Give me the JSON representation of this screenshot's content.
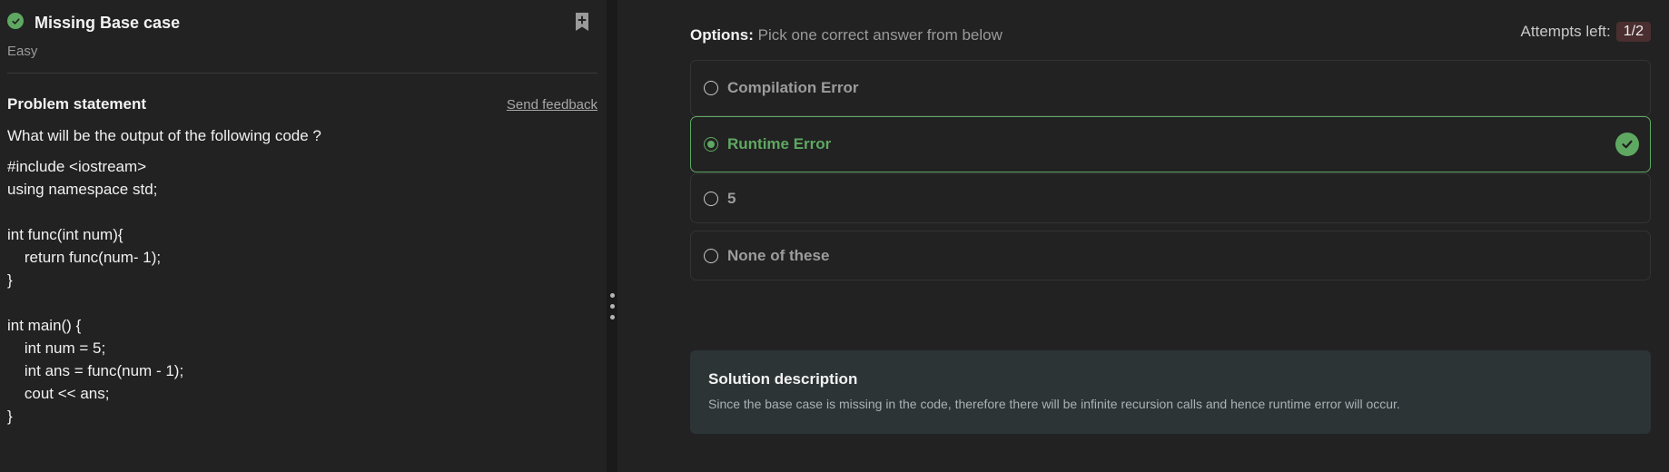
{
  "problem": {
    "title": "Missing Base case",
    "difficulty": "Easy",
    "statement_heading": "Problem statement",
    "feedback_link": "Send feedback",
    "question": "What will be the output of the following code ?",
    "code_lines": [
      "#include <iostream>",
      "using namespace std;",
      "",
      "int func(int num){",
      "    return func(num- 1);",
      "}",
      "",
      "int main() {",
      "    int num = 5;",
      "    int ans = func(num - 1);",
      "    cout << ans;",
      "}"
    ]
  },
  "options": {
    "label": "Options:",
    "instruction": "Pick one correct answer from below",
    "attempts_label": "Attempts left:",
    "attempts_value": "1/2",
    "items": [
      {
        "label": "Compilation Error",
        "selected": false,
        "correct": false
      },
      {
        "label": "Runtime Error",
        "selected": true,
        "correct": true
      },
      {
        "label": "5",
        "selected": false,
        "correct": false
      },
      {
        "label": "None of these",
        "selected": false,
        "correct": false
      }
    ]
  },
  "solution": {
    "heading": "Solution description",
    "text": "Since the base case is missing in the code, therefore there will be infinite recursion calls and hence runtime error will occur."
  },
  "colors": {
    "accent_green": "#5fa862",
    "panel_bg": "#222222",
    "solution_bg": "#2d3436",
    "badge_bg": "#4a2e30"
  },
  "icons": {
    "title_status": "check-circle-icon",
    "bookmark": "bookmark-plus-icon",
    "splitter": "drag-handle-icon",
    "correct_marker": "check-circle-icon"
  }
}
